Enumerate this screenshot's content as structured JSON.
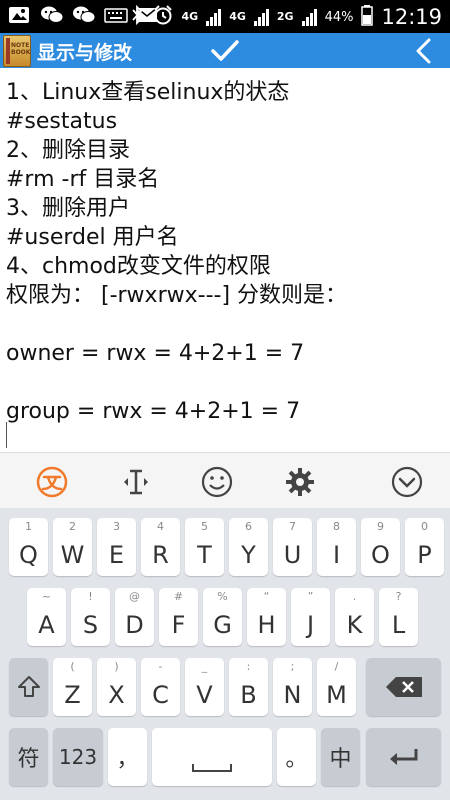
{
  "status_bar": {
    "battery": "44%",
    "time": "12:19",
    "network_a": "4G",
    "network_b": "4G",
    "network_c": "2G"
  },
  "app_bar": {
    "logo_text_line1": "NOTE",
    "logo_text_line2": "BOOK",
    "title": "显示与修改"
  },
  "editor": {
    "lines": [
      "1、Linux查看selinux的状态",
      "#sestatus",
      "2、删除目录",
      "#rm -rf 目录名",
      "3、删除用户",
      "#userdel 用户名",
      "4、chmod改变文件的权限",
      "权限为： [-rwxrwx---] 分数则是：",
      "",
      "owner = rwx = 4+2+1 = 7",
      "",
      "group = rwx = 4+2+1 = 7"
    ]
  },
  "keyboard": {
    "row1": [
      {
        "hint": "1",
        "key": "Q"
      },
      {
        "hint": "2",
        "key": "W"
      },
      {
        "hint": "3",
        "key": "E"
      },
      {
        "hint": "4",
        "key": "R"
      },
      {
        "hint": "5",
        "key": "T"
      },
      {
        "hint": "6",
        "key": "Y"
      },
      {
        "hint": "7",
        "key": "U"
      },
      {
        "hint": "8",
        "key": "I"
      },
      {
        "hint": "9",
        "key": "O"
      },
      {
        "hint": "0",
        "key": "P"
      }
    ],
    "row2": [
      {
        "hint": "~",
        "key": "A"
      },
      {
        "hint": "!",
        "key": "S"
      },
      {
        "hint": "@",
        "key": "D"
      },
      {
        "hint": "#",
        "key": "F"
      },
      {
        "hint": "%",
        "key": "G"
      },
      {
        "hint": "“",
        "key": "H"
      },
      {
        "hint": "”",
        "key": "J"
      },
      {
        "hint": ".",
        "key": "K"
      },
      {
        "hint": "?",
        "key": "L"
      }
    ],
    "row3": [
      {
        "hint": "(",
        "key": "Z"
      },
      {
        "hint": ")",
        "key": "X"
      },
      {
        "hint": "-",
        "key": "C"
      },
      {
        "hint": "_",
        "key": "V"
      },
      {
        "hint": ":",
        "key": "B"
      },
      {
        "hint": ";",
        "key": "N"
      },
      {
        "hint": "/",
        "key": "M"
      }
    ],
    "symbol_key": "符",
    "number_key": "123",
    "comma_key": "，",
    "period_key": "。",
    "lang_key": "中"
  }
}
